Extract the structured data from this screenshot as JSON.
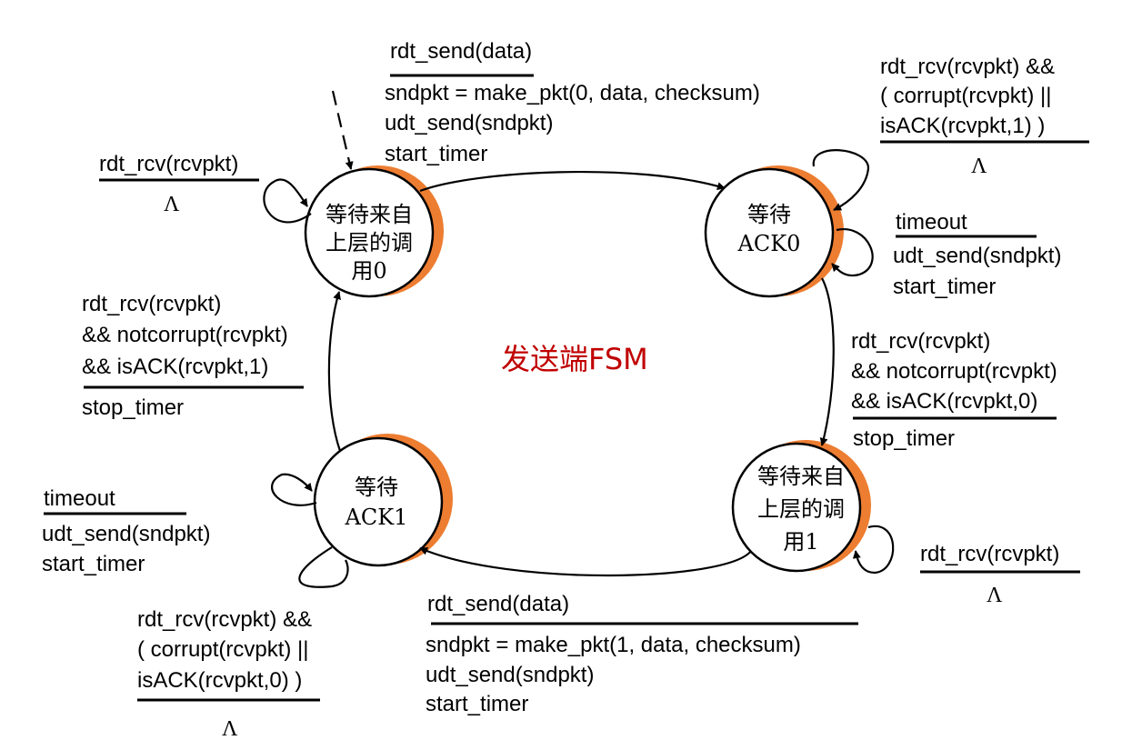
{
  "title": "发送端FSM",
  "colors": {
    "title": "#c00000",
    "state_accent": "#ed7d31",
    "line": "#000000"
  },
  "states": {
    "wait_call0": [
      "等待来自",
      "上层的调",
      "用0"
    ],
    "wait_ack0": [
      "等待",
      "ACK0"
    ],
    "wait_call1": [
      "等待来自",
      "上层的调",
      "用1"
    ],
    "wait_ack1": [
      "等待",
      "ACK1"
    ]
  },
  "transitions": {
    "call0_to_ack0": {
      "event": [
        "rdt_send(data)"
      ],
      "actions": [
        "sndpkt = make_pkt(0, data, checksum)",
        "udt_send(sndpkt)",
        "start_timer"
      ]
    },
    "call0_self": {
      "event": [
        "rdt_rcv(rcvpkt)"
      ],
      "actions": [
        "Λ"
      ]
    },
    "ack0_self_corrupt": {
      "event": [
        "rdt_rcv(rcvpkt) &&",
        "( corrupt(rcvpkt) ||",
        "isACK(rcvpkt,1) )"
      ],
      "actions": [
        "Λ"
      ]
    },
    "ack0_self_timeout": {
      "event": [
        "timeout"
      ],
      "actions": [
        "udt_send(sndpkt)",
        "start_timer"
      ]
    },
    "ack0_to_call1": {
      "event": [
        "rdt_rcv(rcvpkt)",
        "&& notcorrupt(rcvpkt)",
        "&& isACK(rcvpkt,0)"
      ],
      "actions": [
        "stop_timer"
      ]
    },
    "call1_self": {
      "event": [
        "rdt_rcv(rcvpkt)"
      ],
      "actions": [
        "Λ"
      ]
    },
    "call1_to_ack1": {
      "event": [
        "rdt_send(data)"
      ],
      "actions": [
        "sndpkt = make_pkt(1, data, checksum)",
        "udt_send(sndpkt)",
        "start_timer"
      ]
    },
    "ack1_self_timeout": {
      "event": [
        "timeout"
      ],
      "actions": [
        "udt_send(sndpkt)",
        "start_timer"
      ]
    },
    "ack1_self_corrupt": {
      "event": [
        "rdt_rcv(rcvpkt) &&",
        "( corrupt(rcvpkt) ||",
        "isACK(rcvpkt,0) )"
      ],
      "actions": [
        "Λ"
      ]
    },
    "ack1_to_call0": {
      "event": [
        "rdt_rcv(rcvpkt)",
        "&& notcorrupt(rcvpkt)",
        "&& isACK(rcvpkt,1)"
      ],
      "actions": [
        "stop_timer"
      ]
    }
  }
}
